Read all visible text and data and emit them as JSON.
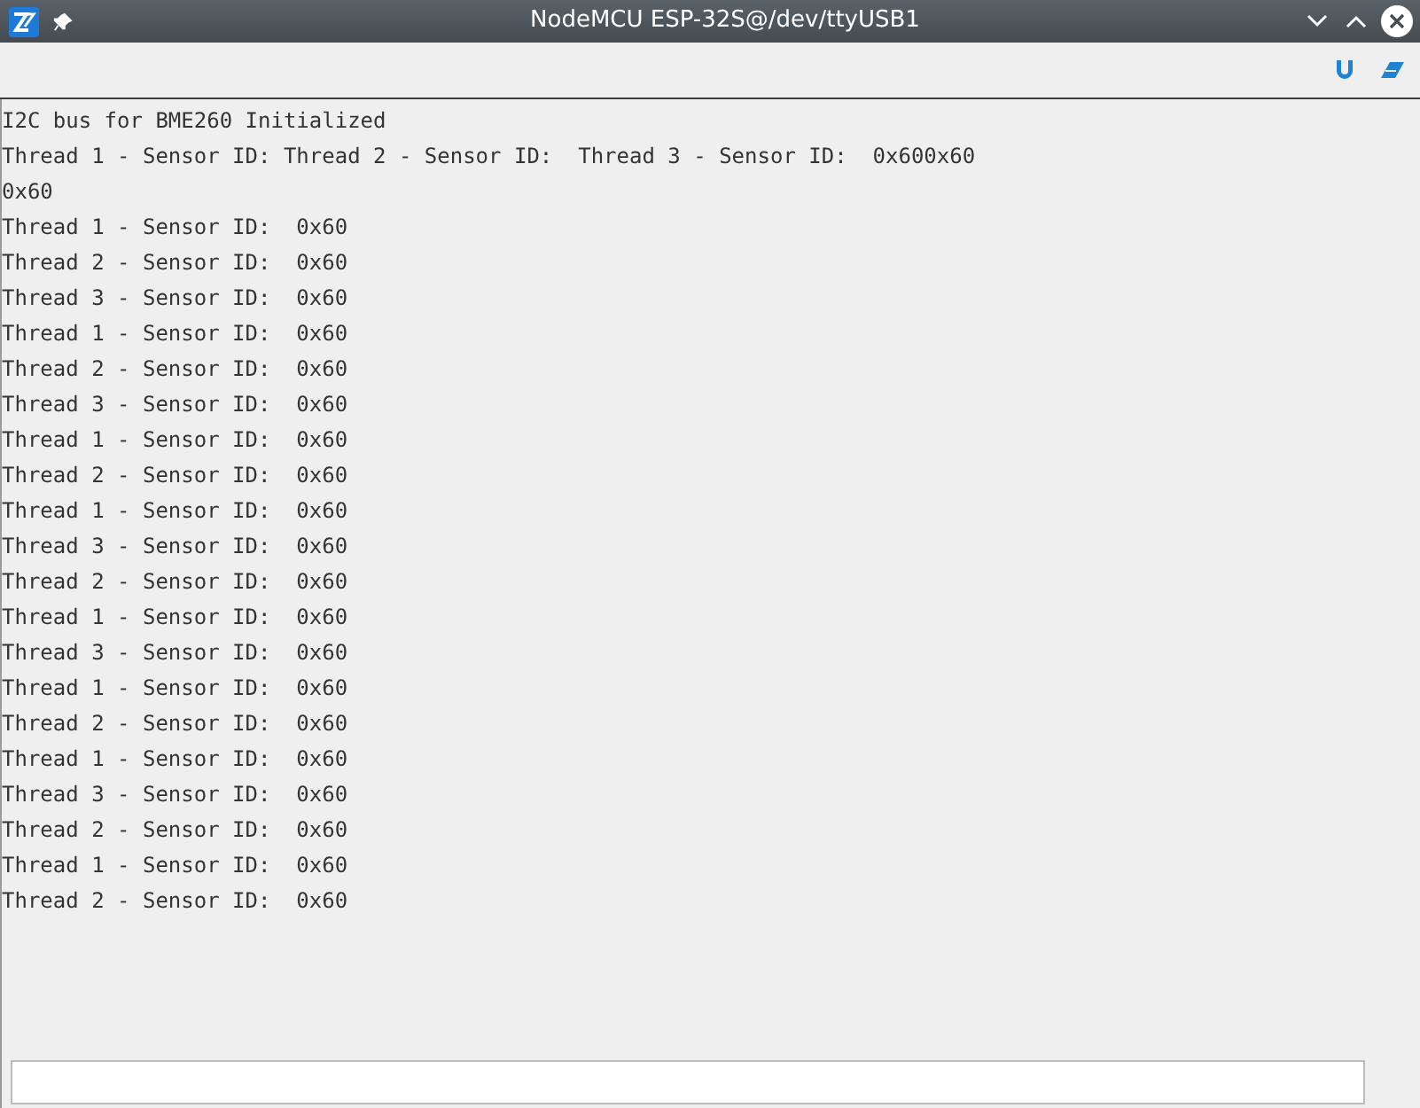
{
  "window": {
    "title": "NodeMCU ESP-32S@/dev/ttyUSB1"
  },
  "output_lines": [
    "I2C bus for BME260 Initialized",
    "Thread 1 - Sensor ID: Thread 2 - Sensor ID:  Thread 3 - Sensor ID:  0x600x60",
    "0x60",
    "Thread 1 - Sensor ID:  0x60",
    "Thread 2 - Sensor ID:  0x60",
    "Thread 3 - Sensor ID:  0x60",
    "Thread 1 - Sensor ID:  0x60",
    "Thread 2 - Sensor ID:  0x60",
    "Thread 3 - Sensor ID:  0x60",
    "Thread 1 - Sensor ID:  0x60",
    "Thread 2 - Sensor ID:  0x60",
    "Thread 1 - Sensor ID:  0x60",
    "Thread 3 - Sensor ID:  0x60",
    "Thread 2 - Sensor ID:  0x60",
    "Thread 1 - Sensor ID:  0x60",
    "Thread 3 - Sensor ID:  0x60",
    "Thread 1 - Sensor ID:  0x60",
    "Thread 2 - Sensor ID:  0x60",
    "Thread 1 - Sensor ID:  0x60",
    "Thread 3 - Sensor ID:  0x60",
    "Thread 2 - Sensor ID:  0x60",
    "Thread 1 - Sensor ID:  0x60",
    "Thread 2 - Sensor ID:  0x60"
  ]
}
